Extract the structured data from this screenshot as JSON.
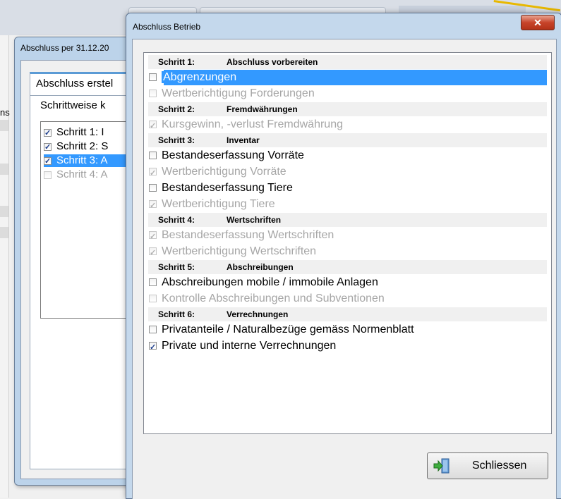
{
  "background": {
    "left_partial_label": "ns",
    "back_dialog": {
      "title": "Abschluss per 31.12.20",
      "tab_label": "Abschluss erstel",
      "label": "Schrittweise k",
      "items": [
        {
          "label": "Schritt 1: I",
          "checked": true,
          "selected": false,
          "disabled": false
        },
        {
          "label": "Schritt 2: S",
          "checked": true,
          "selected": false,
          "disabled": false
        },
        {
          "label": "Schritt 3: A",
          "checked": true,
          "selected": true,
          "disabled": false
        },
        {
          "label": "Schritt 4: A",
          "checked": false,
          "selected": false,
          "disabled": true
        }
      ]
    }
  },
  "dialog": {
    "title": "Abschluss Betrieb",
    "close_icon": "close-x-icon",
    "steps": [
      {
        "step": "Schritt 1:",
        "category": "Abschluss vorbereiten",
        "items": [
          {
            "label": "Abgrenzungen",
            "checked": false,
            "disabled": false,
            "selected": true
          },
          {
            "label": "Wertberichtigung Forderungen",
            "checked": false,
            "disabled": true,
            "selected": false
          }
        ]
      },
      {
        "step": "Schritt 2:",
        "category": "Fremdwährungen",
        "items": [
          {
            "label": "Kursgewinn, -verlust Fremdwährung",
            "checked": true,
            "disabled": true,
            "selected": false
          }
        ]
      },
      {
        "step": "Schritt 3:",
        "category": "Inventar",
        "items": [
          {
            "label": "Bestandeserfassung Vorräte",
            "checked": false,
            "disabled": false,
            "selected": false
          },
          {
            "label": "Wertberichtigung Vorräte",
            "checked": true,
            "disabled": true,
            "selected": false
          },
          {
            "label": "Bestandeserfassung Tiere",
            "checked": false,
            "disabled": false,
            "selected": false
          },
          {
            "label": "Wertberichtigung Tiere",
            "checked": true,
            "disabled": true,
            "selected": false
          }
        ]
      },
      {
        "step": "Schritt 4:",
        "category": "Wertschriften",
        "items": [
          {
            "label": "Bestandeserfassung Wertschriften",
            "checked": true,
            "disabled": true,
            "selected": false
          },
          {
            "label": "Wertberichtigung Wertschriften",
            "checked": true,
            "disabled": true,
            "selected": false
          }
        ]
      },
      {
        "step": "Schritt 5:",
        "category": "Abschreibungen",
        "items": [
          {
            "label": "Abschreibungen mobile / immobile Anlagen",
            "checked": false,
            "disabled": false,
            "selected": false
          },
          {
            "label": "Kontrolle Abschreibungen und Subventionen",
            "checked": false,
            "disabled": true,
            "selected": false
          }
        ]
      },
      {
        "step": "Schritt 6:",
        "category": "Verrechnungen",
        "items": [
          {
            "label": "Privatanteile / Naturalbezüge gemäss Normenblatt",
            "checked": false,
            "disabled": false,
            "selected": false
          },
          {
            "label": "Private und interne Verrechnungen",
            "checked": true,
            "disabled": false,
            "selected": false
          }
        ]
      }
    ],
    "close_button": {
      "label": "Schliessen",
      "icon": "exit-door-icon"
    }
  }
}
